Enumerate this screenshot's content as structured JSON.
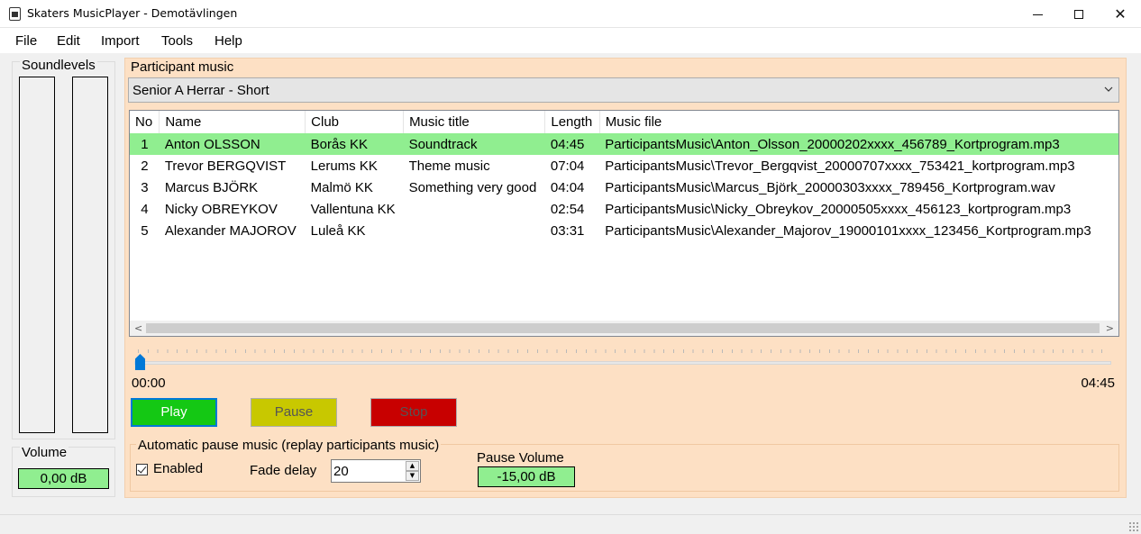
{
  "window": {
    "title": "Skaters MusicPlayer - Demotävlingen"
  },
  "menu": [
    "File",
    "Edit",
    "Import",
    "Tools",
    "Help"
  ],
  "soundlevels": {
    "label": "Soundlevels"
  },
  "volume": {
    "label": "Volume",
    "value": "0,00 dB"
  },
  "participant": {
    "title": "Participant music",
    "selected_class": "Senior A Herrar - Short",
    "columns": [
      "No",
      "Name",
      "Club",
      "Music title",
      "Length",
      "Music file"
    ],
    "rows": [
      [
        "1",
        "Anton OLSSON",
        "Borås KK",
        "Soundtrack",
        "04:45",
        "ParticipantsMusic\\Anton_Olsson_20000202xxxx_456789_Kortprogram.mp3"
      ],
      [
        "2",
        "Trevor BERGQVIST",
        "Lerums KK",
        "Theme music",
        "07:04",
        "ParticipantsMusic\\Trevor_Bergqvist_20000707xxxx_753421_kortprogram.mp3"
      ],
      [
        "3",
        "Marcus BJÖRK",
        "Malmö KK",
        "Something very good",
        "04:04",
        "ParticipantsMusic\\Marcus_Björk_20000303xxxx_789456_Kortprogram.wav"
      ],
      [
        "4",
        "Nicky OBREYKOV",
        "Vallentuna KK",
        "",
        "02:54",
        "ParticipantsMusic\\Nicky_Obreykov_20000505xxxx_456123_kortprogram.mp3"
      ],
      [
        "5",
        "Alexander MAJOROV",
        "Luleå KK",
        "",
        "03:31",
        "ParticipantsMusic\\Alexander_Majorov_19000101xxxx_123456_Kortprogram.mp3"
      ]
    ],
    "selected_row": 0
  },
  "playback": {
    "position": "00:00",
    "duration": "04:45",
    "progress_fraction": 0.0
  },
  "buttons": {
    "play": "Play",
    "pause": "Pause",
    "stop": "Stop"
  },
  "auto_pause": {
    "title": "Automatic pause music (replay participants music)",
    "enabled_label": "Enabled",
    "enabled": true,
    "fade_delay_label": "Fade delay",
    "fade_delay": "20",
    "pause_volume_label": "Pause Volume",
    "pause_volume": "-15,00 dB"
  },
  "colors": {
    "panel": "#fde0c4",
    "selected_row": "#90ee90",
    "play": "#14c814",
    "pause": "#c8c800",
    "stop": "#c80000"
  }
}
